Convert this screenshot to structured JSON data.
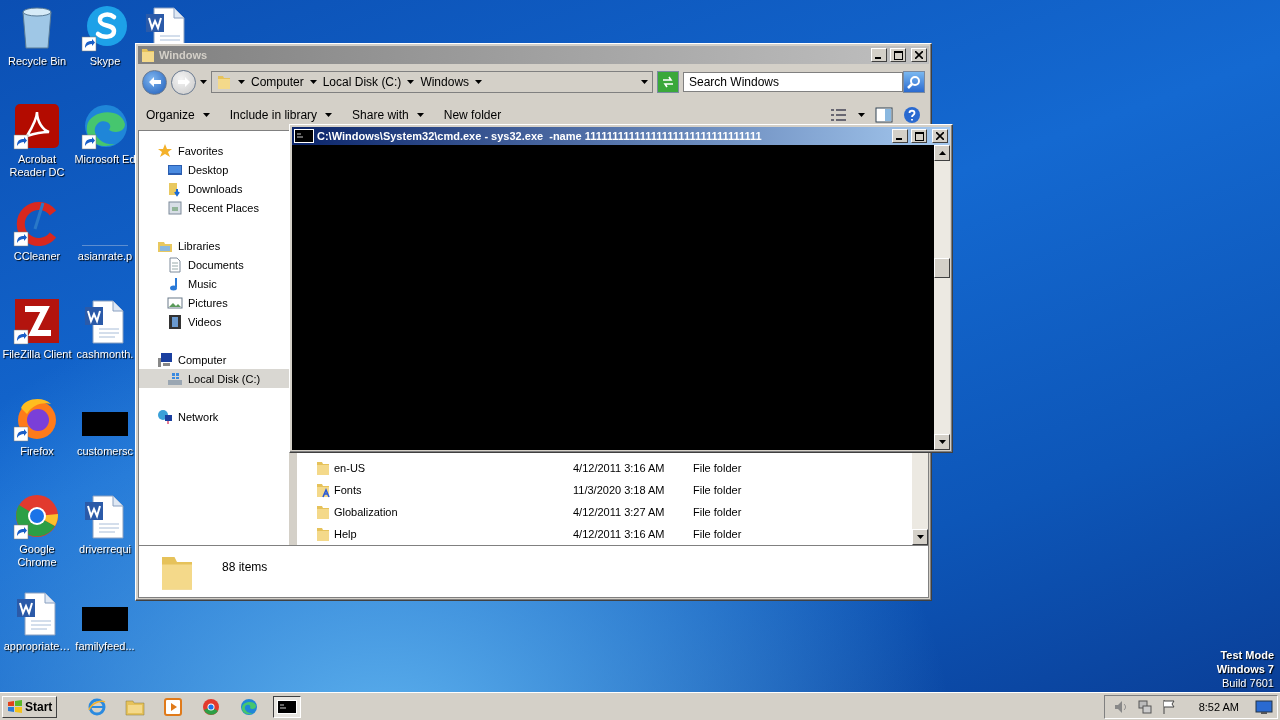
{
  "desktop_icons": [
    {
      "label": "Recycle Bin",
      "kind": "recycle"
    },
    {
      "label": "Acrobat Reader DC",
      "kind": "acrobat"
    },
    {
      "label": "CCleaner",
      "kind": "ccleaner"
    },
    {
      "label": "FileZilla Client",
      "kind": "filezilla"
    },
    {
      "label": "Firefox",
      "kind": "firefox"
    },
    {
      "label": "Google Chrome",
      "kind": "chrome"
    },
    {
      "label": "appropriate…",
      "kind": "word"
    },
    {
      "label": "Skype",
      "kind": "skype"
    },
    {
      "label": "Microsoft Ed",
      "kind": "edge"
    },
    {
      "label": "asianrate.p",
      "kind": "blank"
    },
    {
      "label": "cashmonth.",
      "kind": "word"
    },
    {
      "label": "customersc",
      "kind": "redacted"
    },
    {
      "label": "driverrequi",
      "kind": "word"
    },
    {
      "label": "familyfeed...",
      "kind": "redacted"
    },
    {
      "kind": "word"
    }
  ],
  "explorer": {
    "title": "Windows",
    "breadcrumb": [
      "Computer",
      "Local Disk (C:)",
      "Windows"
    ],
    "search": {
      "placeholder": "Search Windows"
    },
    "toolbar": [
      {
        "label": "Organize",
        "has_menu": true
      },
      {
        "label": "Include in library",
        "has_menu": true
      },
      {
        "label": "Share with",
        "has_menu": true
      },
      {
        "label": "New folder",
        "has_menu": false
      }
    ],
    "sidebar": [
      {
        "label": "Favorites",
        "kind": "star",
        "selected": false,
        "children": [
          {
            "label": "Desktop",
            "kind": "desktop",
            "selected": false
          },
          {
            "label": "Downloads",
            "kind": "downloads",
            "selected": false
          },
          {
            "label": "Recent Places",
            "kind": "recent",
            "selected": false
          }
        ]
      },
      {
        "label": "Libraries",
        "kind": "library",
        "selected": false,
        "children": [
          {
            "label": "Documents",
            "kind": "documents",
            "selected": false
          },
          {
            "label": "Music",
            "kind": "music",
            "selected": false
          },
          {
            "label": "Pictures",
            "kind": "pictures",
            "selected": false
          },
          {
            "label": "Videos",
            "kind": "videos",
            "selected": false
          }
        ]
      },
      {
        "label": "Computer",
        "kind": "computer",
        "selected": false,
        "children": [
          {
            "label": "Local Disk (C:)",
            "kind": "disk",
            "selected": true
          }
        ]
      },
      {
        "label": "Network",
        "kind": "network",
        "selected": false
      }
    ],
    "files": [
      {
        "name": "en-US",
        "date": "4/12/2011 3:16 AM",
        "type": "File folder",
        "kind": "folder"
      },
      {
        "name": "Fonts",
        "date": "11/3/2020 3:18 AM",
        "type": "File folder",
        "kind": "fonts"
      },
      {
        "name": "Globalization",
        "date": "4/12/2011 3:27 AM",
        "type": "File folder",
        "kind": "folder"
      },
      {
        "name": "Help",
        "date": "4/12/2011 3:16 AM",
        "type": "File folder",
        "kind": "folder"
      }
    ],
    "status": "88 items"
  },
  "console": {
    "title": "C:\\Windows\\System32\\cmd.exe - sys32.exe  -name 11111111111111111111111111111111"
  },
  "taskbar": {
    "start": "Start",
    "apps": [
      {
        "kind": "ie",
        "active": false
      },
      {
        "kind": "explorer",
        "active": false
      },
      {
        "kind": "media",
        "active": false
      },
      {
        "kind": "chrome",
        "active": false
      },
      {
        "kind": "edge",
        "active": false
      },
      {
        "kind": "cmd",
        "active": true
      }
    ],
    "clock": "8:52 AM"
  },
  "desktop_notice": [
    {
      "text": "Test Mode",
      "bold": true
    },
    {
      "text": "Windows 7",
      "bold": true
    },
    {
      "text": "Build 7601",
      "bold": false
    }
  ]
}
